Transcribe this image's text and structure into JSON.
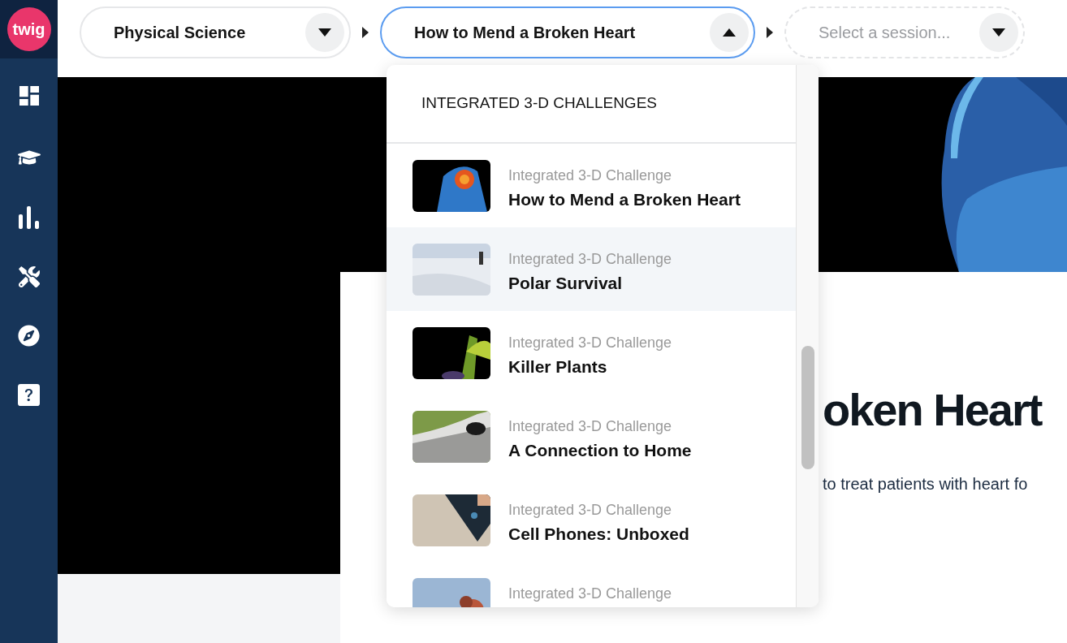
{
  "logo": {
    "text": "twig"
  },
  "breadcrumb": [
    {
      "kind": "select",
      "value": "Physical Science",
      "expanded": false
    },
    {
      "kind": "select",
      "value": "How to Mend a Broken Heart",
      "expanded": true
    },
    {
      "kind": "placeholder",
      "placeholder": "Select a session...",
      "expanded": false
    }
  ],
  "dropdown": {
    "heading": "INTEGRATED 3-D CHALLENGES",
    "items": [
      {
        "subtitle": "Integrated 3-D Challenge",
        "title": "How to Mend a Broken Heart",
        "hovered": false
      },
      {
        "subtitle": "Integrated 3-D Challenge",
        "title": "Polar Survival",
        "hovered": true
      },
      {
        "subtitle": "Integrated 3-D Challenge",
        "title": "Killer Plants",
        "hovered": false
      },
      {
        "subtitle": "Integrated 3-D Challenge",
        "title": "A Connection to Home",
        "hovered": false
      },
      {
        "subtitle": "Integrated 3-D Challenge",
        "title": "Cell Phones: Unboxed",
        "hovered": false
      },
      {
        "subtitle": "Integrated 3-D Challenge",
        "hovered": false
      }
    ]
  },
  "content": {
    "heading": "oken Heart",
    "description": "to treat patients with heart fo"
  }
}
